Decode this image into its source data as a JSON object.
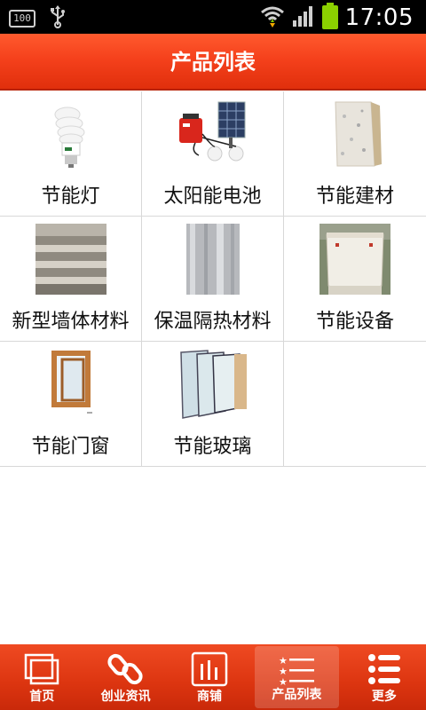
{
  "status_bar": {
    "battery_small": "100",
    "time": "17:05"
  },
  "header": {
    "title": "产品列表"
  },
  "products": [
    {
      "label": "节能灯",
      "icon": "cfl-bulb-icon"
    },
    {
      "label": "太阳能电池",
      "icon": "solar-kit-icon"
    },
    {
      "label": "节能建材",
      "icon": "panel-board-icon"
    },
    {
      "label": "新型墙体材料",
      "icon": "wall-stack-icon"
    },
    {
      "label": "保温隔热材料",
      "icon": "foil-insulation-icon"
    },
    {
      "label": "节能设备",
      "icon": "cooling-tower-icon"
    },
    {
      "label": "节能门窗",
      "icon": "window-frame-icon"
    },
    {
      "label": "节能玻璃",
      "icon": "glass-panes-icon"
    }
  ],
  "bottom_nav": {
    "items": [
      {
        "label": "首页",
        "icon": "home-pages-icon"
      },
      {
        "label": "创业资讯",
        "icon": "link-chain-icon"
      },
      {
        "label": "商铺",
        "icon": "store-bars-icon"
      },
      {
        "label": "产品列表",
        "icon": "star-list-icon",
        "active": true
      },
      {
        "label": "更多",
        "icon": "more-list-icon"
      }
    ]
  },
  "colors": {
    "accent": "#ef4a22",
    "title_bar": "#f5411c"
  }
}
